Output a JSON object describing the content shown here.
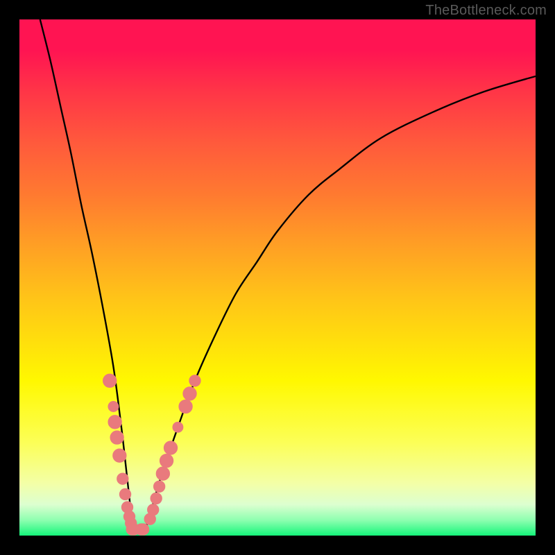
{
  "watermark": {
    "text": "TheBottleneck.com"
  },
  "colors": {
    "curve_stroke": "#000000",
    "marker_fill": "#e97a7d",
    "marker_stroke": "#e97a7d"
  },
  "chart_data": {
    "type": "line",
    "title": "",
    "xlabel": "",
    "ylabel": "",
    "xlim": [
      0,
      100
    ],
    "ylim": [
      0,
      100
    ],
    "grid": false,
    "legend": false,
    "series": [
      {
        "name": "bottleneck-curve",
        "x": [
          4,
          6,
          8,
          10,
          12,
          14,
          16,
          18,
          19,
          20,
          21,
          22,
          23,
          24,
          25,
          27,
          30,
          34,
          38,
          42,
          46,
          50,
          56,
          62,
          70,
          80,
          90,
          100
        ],
        "y": [
          100,
          92,
          83,
          74,
          64,
          55,
          45,
          34,
          27,
          19,
          10,
          2,
          1,
          1,
          3,
          10,
          19,
          30,
          39,
          47,
          53,
          59,
          66,
          71,
          77,
          82,
          86,
          89
        ]
      }
    ],
    "markers": [
      {
        "name": "cluster-left-upper",
        "style": "circle",
        "points": [
          {
            "x": 17.5,
            "y": 30,
            "r": 1.3
          },
          {
            "x": 18.2,
            "y": 25,
            "r": 1.0
          },
          {
            "x": 18.5,
            "y": 22,
            "r": 1.3
          },
          {
            "x": 18.9,
            "y": 19,
            "r": 1.3
          },
          {
            "x": 19.4,
            "y": 15.5,
            "r": 1.3
          }
        ]
      },
      {
        "name": "cluster-left-lower",
        "style": "circle",
        "points": [
          {
            "x": 20.0,
            "y": 11,
            "r": 1.1
          },
          {
            "x": 20.5,
            "y": 8,
            "r": 1.1
          },
          {
            "x": 20.9,
            "y": 5.5,
            "r": 1.1
          },
          {
            "x": 21.3,
            "y": 3.7,
            "r": 1.1
          },
          {
            "x": 21.6,
            "y": 2.4,
            "r": 1.1
          }
        ]
      },
      {
        "name": "cluster-bottom",
        "style": "pill",
        "points": [
          {
            "x": 22.0,
            "y": 1.2,
            "w": 2.6,
            "h": 2.2
          },
          {
            "x": 23.8,
            "y": 1.2,
            "w": 2.6,
            "h": 2.2
          }
        ]
      },
      {
        "name": "cluster-right-lower",
        "style": "circle",
        "points": [
          {
            "x": 25.3,
            "y": 3.2,
            "r": 1.1
          },
          {
            "x": 25.9,
            "y": 5.0,
            "r": 1.1
          },
          {
            "x": 26.5,
            "y": 7.2,
            "r": 1.1
          },
          {
            "x": 27.1,
            "y": 9.5,
            "r": 1.1
          },
          {
            "x": 27.8,
            "y": 12.0,
            "r": 1.3
          },
          {
            "x": 28.5,
            "y": 14.5,
            "r": 1.3
          },
          {
            "x": 29.3,
            "y": 17.0,
            "r": 1.3
          }
        ]
      },
      {
        "name": "cluster-right-upper",
        "style": "circle",
        "points": [
          {
            "x": 30.7,
            "y": 21.0,
            "r": 1.0
          },
          {
            "x": 32.2,
            "y": 25.0,
            "r": 1.3
          },
          {
            "x": 33.0,
            "y": 27.5,
            "r": 1.3
          },
          {
            "x": 34.0,
            "y": 30.0,
            "r": 1.1
          }
        ]
      }
    ]
  }
}
